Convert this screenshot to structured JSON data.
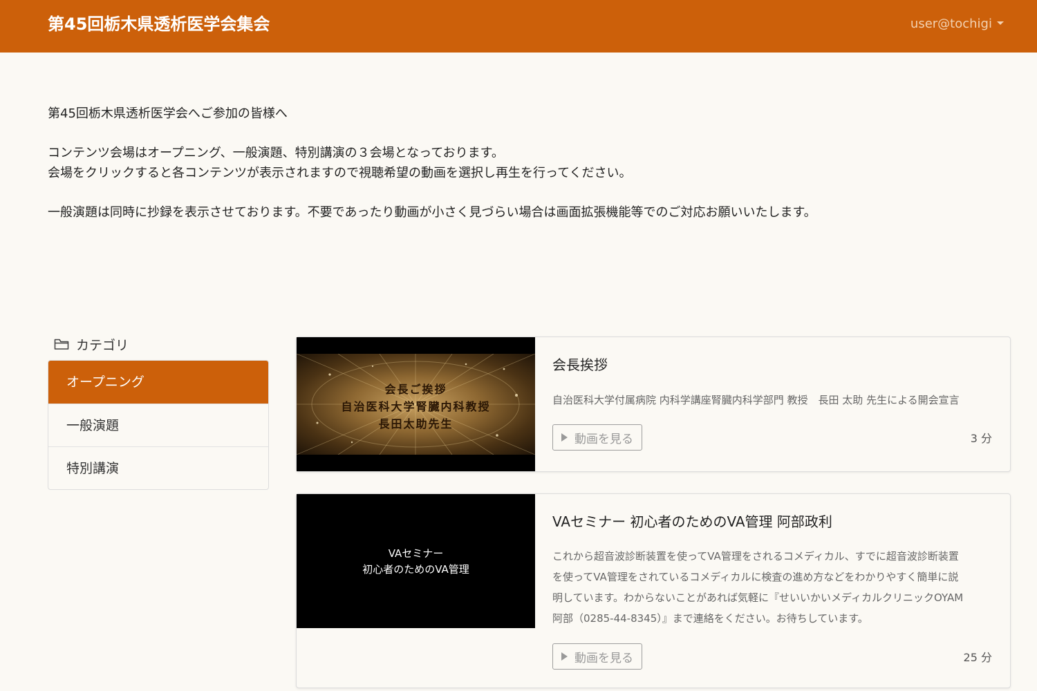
{
  "header": {
    "title": "第45回栃木県透析医学会集会",
    "user": "user@tochigi"
  },
  "intro": {
    "line1": "第45回栃木県透析医学会へご参加の皆様へ",
    "line2": "コンテンツ会場はオープニング、一般演題、特別講演の３会場となっております。",
    "line3": "会場をクリックすると各コンテンツが表示されますので視聴希望の動画を選択し再生を行ってください。",
    "line4": "一般演題は同時に抄録を表示させております。不要であったり動画が小さく見づらい場合は画面拡張機能等でのご対応お願いいたします。"
  },
  "sidebar": {
    "heading": "カテゴリ",
    "icon": "folder-icon",
    "items": [
      {
        "label": "オープニング",
        "active": true
      },
      {
        "label": "一般演題",
        "active": false
      },
      {
        "label": "特別講演",
        "active": false
      }
    ]
  },
  "videos": [
    {
      "title": "会長挨拶",
      "description": "自治医科大学付属病院 内科学講座腎臓内科学部門 教授　長田 太助 先生による開会宣言",
      "thumbnail_lines": [
        "会長ご挨拶",
        "自治医科大学腎臓内科教授",
        "長田太助先生"
      ],
      "button": "動画を見る",
      "duration": "3 分"
    },
    {
      "title": "VAセミナー 初心者のためのVA管理 阿部政利",
      "description_lines": [
        "これから超音波診断装置を使ってVA管理をされるコメディカル、すでに超音波診断装置",
        "を使ってVA管理をされているコメディカルに検査の進め方などをわかりやすく簡単に説",
        "明しています。わからないことがあれば気軽に『せいいかいメディカルクリニックOYAM",
        "阿部（0285-44-8345）』まで連絡をください。お待ちしています。"
      ],
      "thumbnail_lines": [
        "VAセミナー",
        "初心者のためのVA管理"
      ],
      "button": "動画を見る",
      "duration": "25 分"
    }
  ],
  "colors": {
    "accent": "#cc600a",
    "background": "#fbf9f4"
  }
}
